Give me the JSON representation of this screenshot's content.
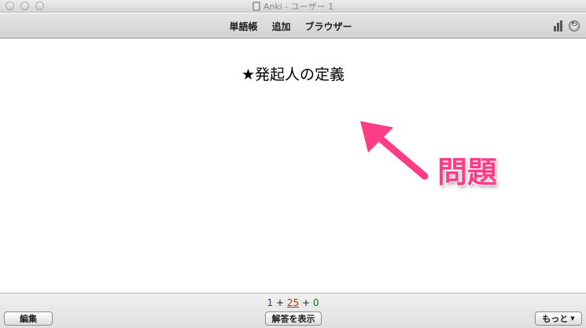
{
  "window": {
    "title": "Anki - ユーザー 1",
    "app_icon": "anki-app-icon"
  },
  "toolbar": {
    "nav": [
      {
        "label": "単語帳"
      },
      {
        "label": "追加"
      },
      {
        "label": "ブラウザー"
      }
    ],
    "icons": [
      "stats-icon",
      "sync-icon"
    ]
  },
  "card": {
    "question": "★発起人の定義"
  },
  "annotation": {
    "label": "問題",
    "color": "#ff3c86"
  },
  "bottom": {
    "counts": {
      "new": "1",
      "learning": "25",
      "review": "0",
      "sep": "+"
    },
    "edit_label": "編集",
    "show_answer_label": "解答を表示",
    "more_label": "もっと"
  },
  "colors": {
    "new": "#1a35c8",
    "learning": "#b4360c",
    "review": "#0b7a12"
  }
}
